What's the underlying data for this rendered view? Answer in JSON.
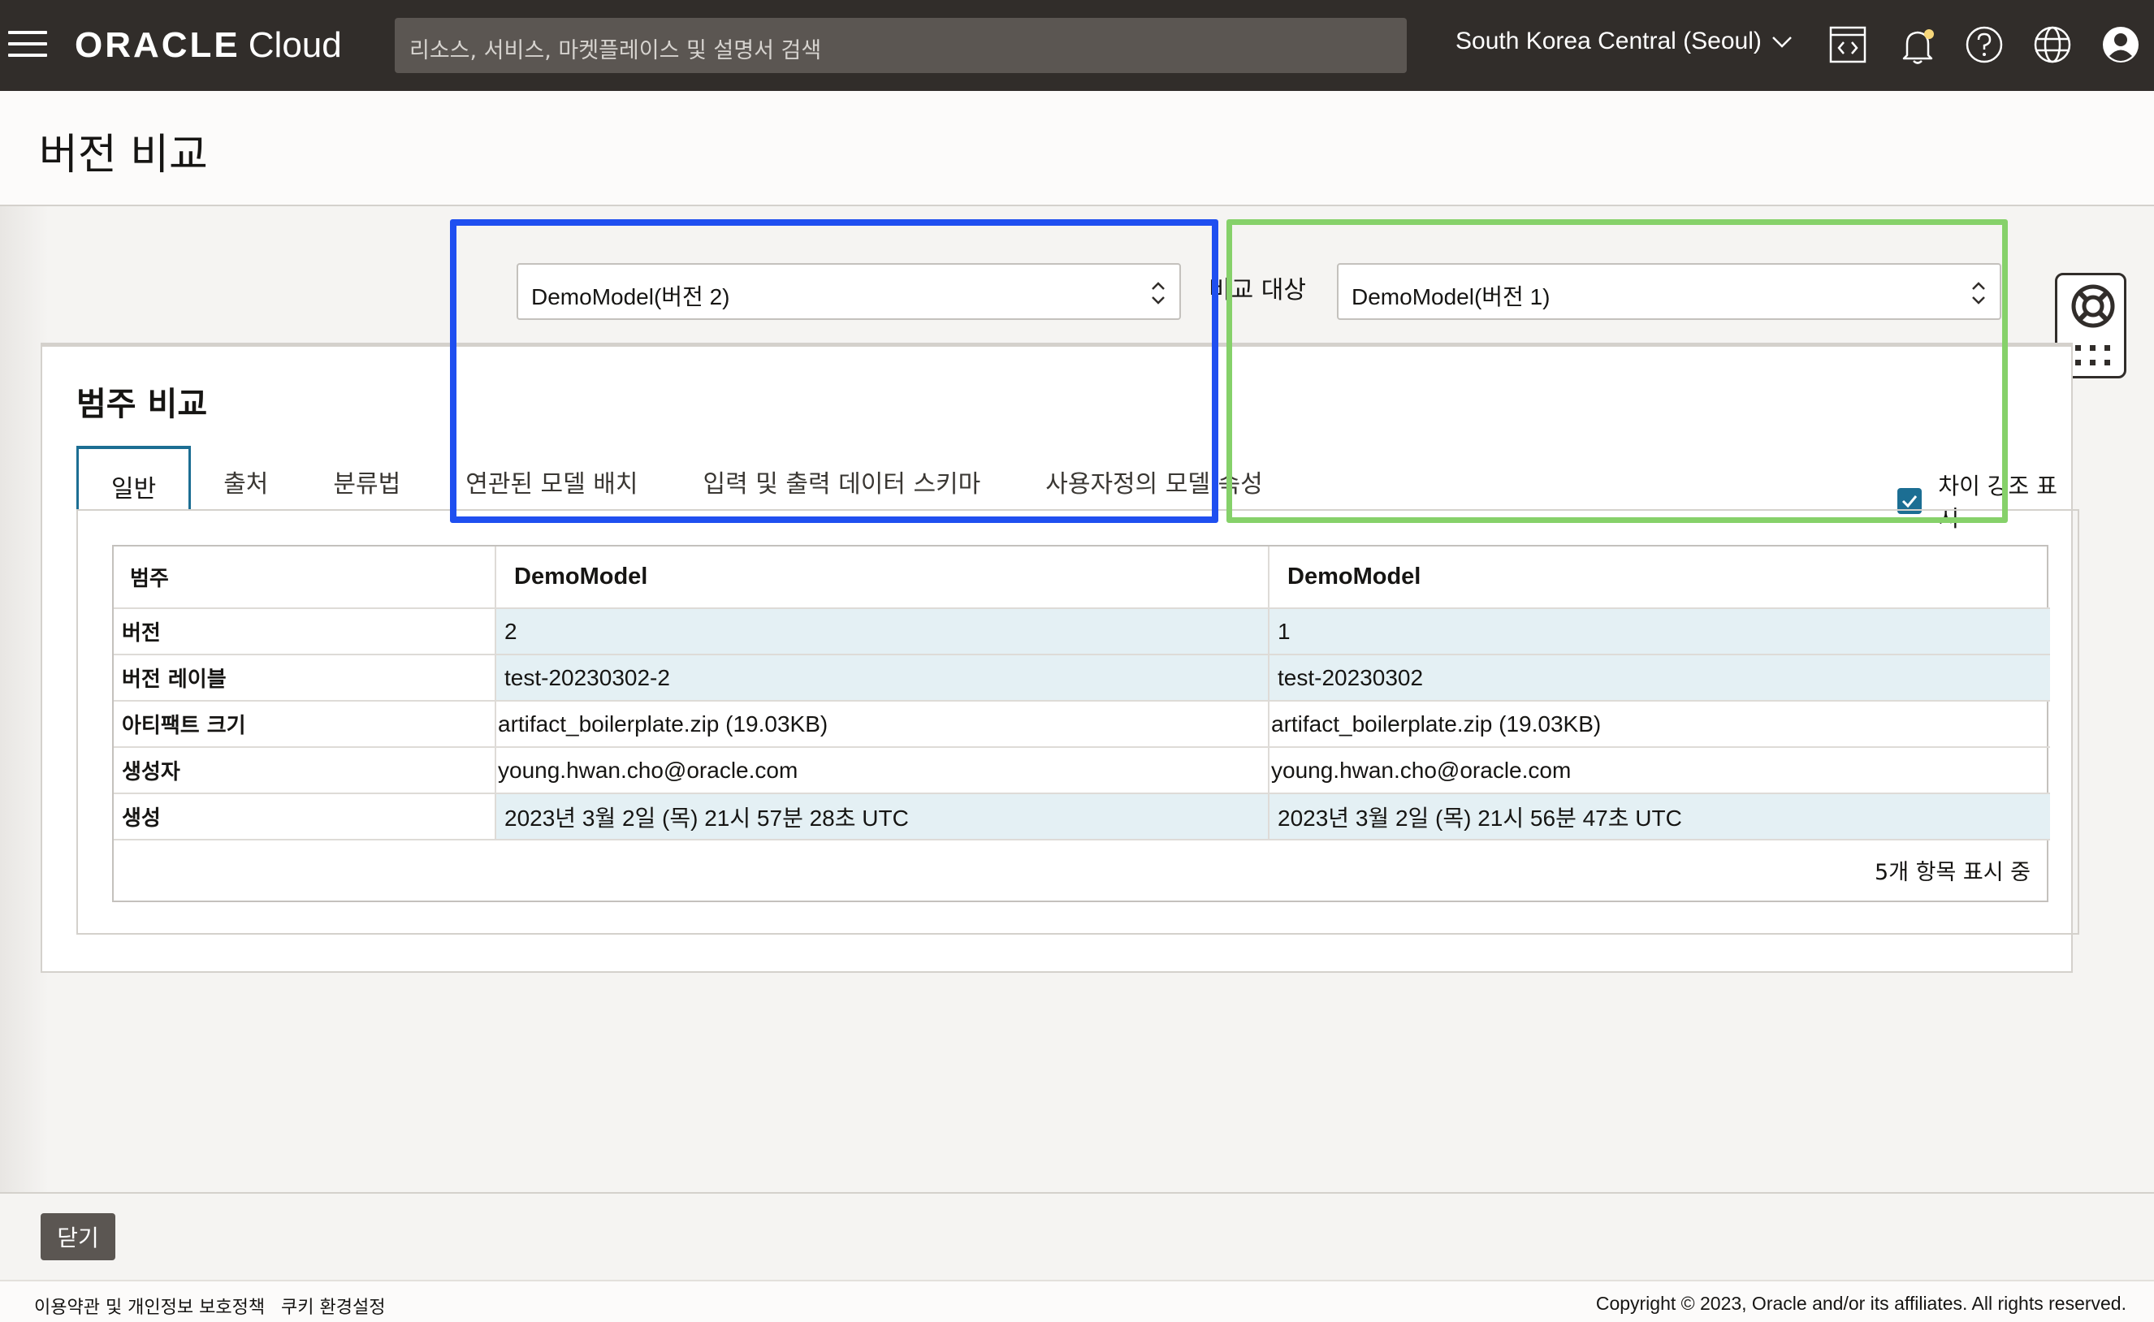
{
  "topbar": {
    "brand_oracle": "ORACLE",
    "brand_cloud": "Cloud",
    "search_placeholder": "리소스, 서비스, 마켓플레이스 및 설명서 검색",
    "region": "South Korea Central (Seoul)"
  },
  "page": {
    "title": "버전 비교"
  },
  "compare": {
    "left_value": "DemoModel(버전 2)",
    "label": "비교 대상",
    "right_value": "DemoModel(버전 1)"
  },
  "panel": {
    "title": "범주 비교",
    "tabs": [
      "일반",
      "출처",
      "분류법",
      "연관된 모델 배치",
      "입력 및 출력 데이터 스키마",
      "사용자정의 모델 속성"
    ],
    "highlight_label": "차이 강조 표시",
    "highlight_checked": true
  },
  "table": {
    "headers": [
      "범주",
      "DemoModel",
      "DemoModel"
    ],
    "rows": [
      {
        "label": "버전",
        "left": "2",
        "right": "1"
      },
      {
        "label": "버전 레이블",
        "left": "test-20230302-2",
        "right": "test-20230302"
      },
      {
        "label": "아티팩트 크기",
        "left": "artifact_boilerplate.zip (19.03KB)",
        "right": "artifact_boilerplate.zip (19.03KB)"
      },
      {
        "label": "생성자",
        "left": "young.hwan.cho@oracle.com",
        "right": "young.hwan.cho@oracle.com"
      },
      {
        "label": "생성",
        "left": "2023년 3월 2일 (목) 21시 57분 28초 UTC",
        "right": "2023년 3월 2일 (목) 21시 56분 47초 UTC"
      }
    ],
    "footer": "5개 항목 표시 중"
  },
  "actions": {
    "close": "닫기"
  },
  "footer": {
    "terms": "이용약관 및 개인정보 보호정책",
    "cookies": "쿠키 환경설정",
    "copyright": "Copyright © 2023, Oracle and/or its affiliates. All rights reserved."
  },
  "colors": {
    "topbar": "#312d2a",
    "accent": "#1c6e93",
    "highlight_blue": "#1f4ff0",
    "highlight_green": "#86d16a",
    "diff_row": "#e4f0f4"
  }
}
